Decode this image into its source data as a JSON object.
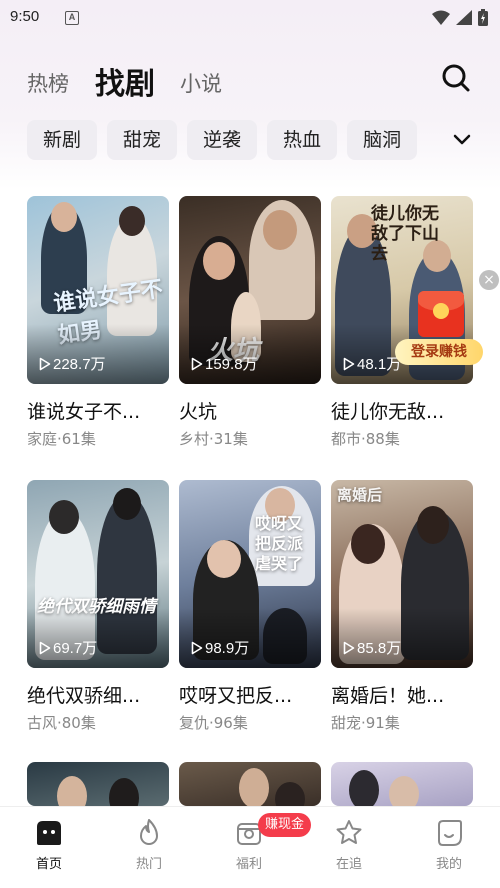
{
  "status_bar": {
    "time": "9:50",
    "app_icon_letter": "A"
  },
  "header": {
    "tabs": [
      {
        "label": "热榜"
      },
      {
        "label": "找剧",
        "active": true
      },
      {
        "label": "小说"
      }
    ]
  },
  "genres": [
    "新剧",
    "甜宠",
    "逆袭",
    "热血",
    "脑洞"
  ],
  "dramas": [
    {
      "title": "谁说女子不...",
      "meta": "家庭·61集",
      "views": "228.7万",
      "poster_text": "谁说女子不如男"
    },
    {
      "title": "火坑",
      "meta": "乡村·31集",
      "views": "159.8万",
      "poster_text": "火坑"
    },
    {
      "title": "徒儿你无敌...",
      "meta": "都市·88集",
      "views": "48.1万",
      "poster_text": "徒儿你无敌了下山去"
    },
    {
      "title": "绝代双骄细...",
      "meta": "古风·80集",
      "views": "69.7万",
      "poster_text": "绝代双骄细雨情"
    },
    {
      "title": "哎呀又把反...",
      "meta": "复仇·96集",
      "views": "98.9万",
      "poster_text": "哎呀又把反派虐哭了"
    },
    {
      "title": "离婚后！她...",
      "meta": "甜宠·91集",
      "views": "85.8万",
      "poster_text": "离婚后"
    }
  ],
  "float_ad": {
    "label": "登录赚钱",
    "close": "×"
  },
  "bottom_nav": {
    "items": [
      {
        "label": "首页",
        "icon": "home-icon",
        "active": true
      },
      {
        "label": "热门",
        "icon": "flame-icon"
      },
      {
        "label": "福利",
        "icon": "gift-icon"
      },
      {
        "label": "在追",
        "icon": "star-icon"
      },
      {
        "label": "我的",
        "icon": "profile-icon"
      }
    ],
    "earn_badge": "赚现金"
  },
  "colors": {
    "accent": "#f43c4b",
    "chip_bg": "#efedf2",
    "ad_gold": "#ffd66b"
  }
}
